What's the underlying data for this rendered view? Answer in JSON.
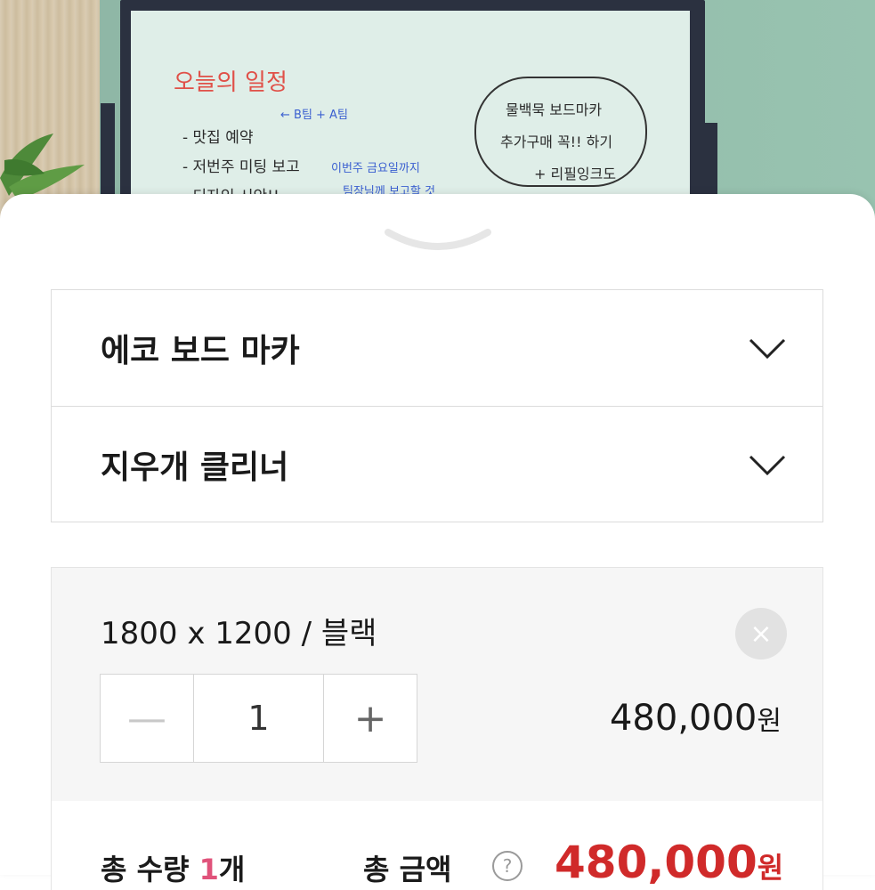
{
  "hero": {
    "board_title": "오늘의 일정",
    "items": [
      "- 맛집 예약",
      "- 저번주 미팅 보고",
      "- 디자인 시안!!"
    ],
    "notes": [
      "← B팀 + A팀",
      "이번주 금요일까지",
      "팀장님께 보고할 것"
    ],
    "bubble_lines": [
      "물백묵 보드마카",
      "추가구매 꼭!! 하기",
      "+ 리필잉크도"
    ]
  },
  "options": [
    {
      "label": "에코 보드 마카"
    },
    {
      "label": "지우개 클리너"
    }
  ],
  "selected": {
    "title": "1800 x 1200 / 블랙",
    "remove_symbol": "×",
    "minus": "—",
    "quantity": "1",
    "plus": "+",
    "price": "480,000",
    "currency": "원"
  },
  "total": {
    "qty_label": "총 수량",
    "qty_value": "1",
    "qty_unit": "개",
    "amount_label": "총 금액",
    "help": "?",
    "amount": "480,000",
    "currency": "원"
  },
  "colors": {
    "accent_red": "#d02a2a",
    "qty_pink": "#e0527a"
  }
}
